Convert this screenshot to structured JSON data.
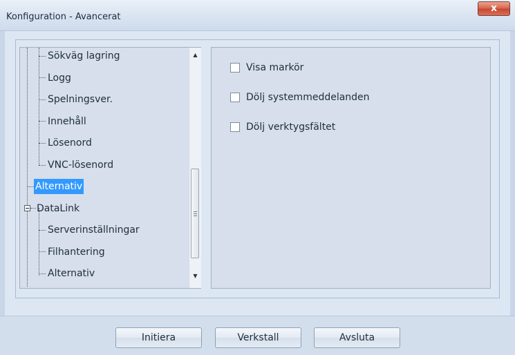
{
  "window": {
    "title": "Konfiguration - Avancerat",
    "close_label": "x"
  },
  "tree": {
    "items": [
      {
        "label": "Sökväg lagring",
        "selected": false
      },
      {
        "label": "Logg",
        "selected": false
      },
      {
        "label": "Spelningsver.",
        "selected": false
      },
      {
        "label": "Innehåll",
        "selected": false
      },
      {
        "label": "Lösenord",
        "selected": false
      },
      {
        "label": "VNC-lösenord",
        "selected": false
      },
      {
        "label": "Alternativ",
        "selected": true
      },
      {
        "label": "DataLink",
        "selected": false
      },
      {
        "label": "Serverinställningar",
        "selected": false
      },
      {
        "label": "Filhantering",
        "selected": false
      },
      {
        "label": "Alternativ",
        "selected": false
      }
    ],
    "scroll_up_icon": "scroll-up-arrow-icon",
    "scroll_down_icon": "scroll-down-arrow-icon"
  },
  "options": [
    {
      "label": "Visa markör",
      "checked": false
    },
    {
      "label": "Dölj systemmeddelanden",
      "checked": false
    },
    {
      "label": "Dölj verktygsfältet",
      "checked": false
    }
  ],
  "buttons": {
    "initiate": "Initiera",
    "apply": "Verkstall",
    "exit": "Avsluta"
  },
  "colors": {
    "selection": "#3399ff",
    "close_button": "#d6634b"
  }
}
